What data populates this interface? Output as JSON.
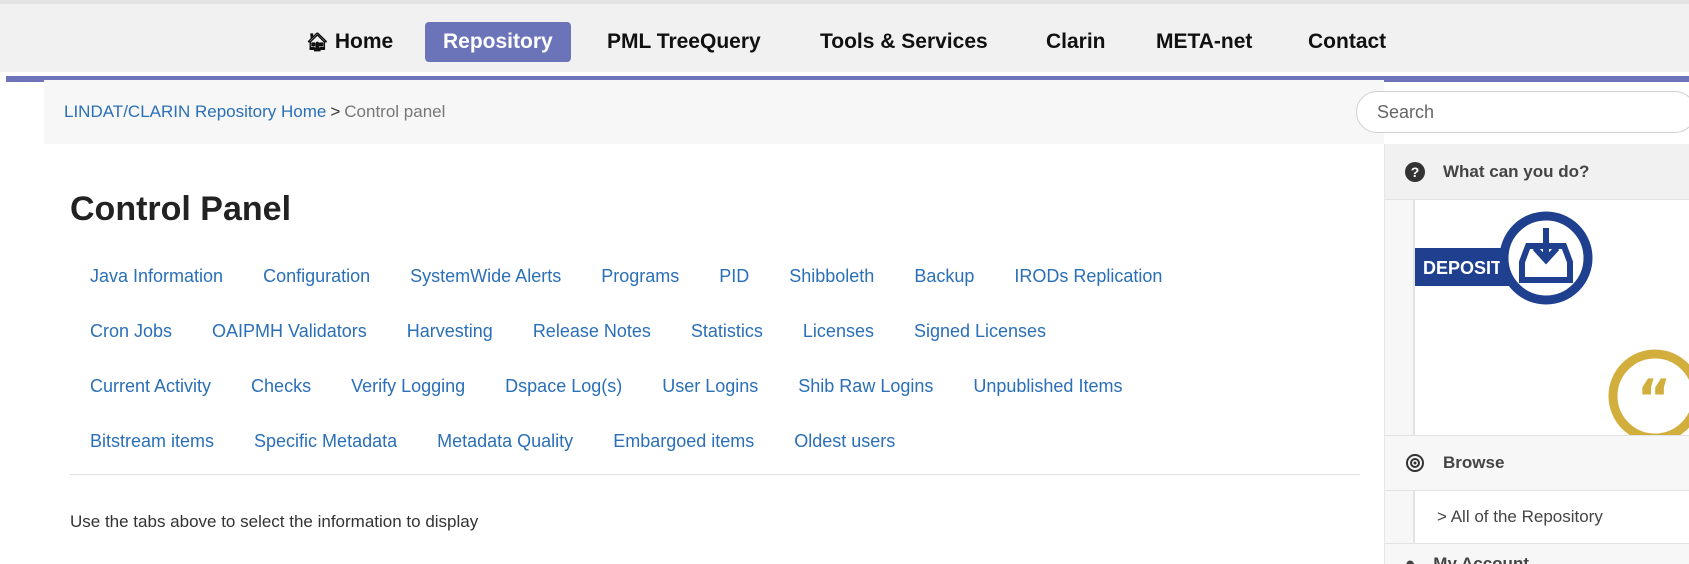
{
  "nav": {
    "home": "Home",
    "items": [
      "Repository",
      "PML TreeQuery",
      "Tools & Services",
      "Clarin",
      "META-net",
      "Contact"
    ]
  },
  "breadcrumb": {
    "home_link": "LINDAT/CLARIN Repository Home",
    "separator": ">",
    "current": "Control panel"
  },
  "search": {
    "placeholder": "Search"
  },
  "main": {
    "title": "Control Panel",
    "tab_rows": [
      [
        "Java Information",
        "Configuration",
        "SystemWide Alerts",
        "Programs",
        "PID",
        "Shibboleth",
        "Backup",
        "IRODs Replication"
      ],
      [
        "Cron Jobs",
        "OAIPMH Validators",
        "Harvesting",
        "Release Notes",
        "Statistics",
        "Licenses",
        "Signed Licenses"
      ],
      [
        "Current Activity",
        "Checks",
        "Verify Logging",
        "Dspace Log(s)",
        "User Logins",
        "Shib Raw Logins",
        "Unpublished Items"
      ],
      [
        "Bitstream items",
        "Specific Metadata",
        "Metadata Quality",
        "Embargoed items",
        "Oldest users"
      ]
    ],
    "help_text": "Use the tabs above to select the information to display"
  },
  "sidebar": {
    "what_can_you_do": "What can you do?",
    "deposit_label": "DEPOSIT",
    "browse_title": "Browse",
    "browse_link": "> All of the Repository",
    "account_title": "My Account"
  },
  "colors": {
    "accent": "#6b74b8",
    "link": "#2a6fb7",
    "deposit_blue": "#1f3f8f",
    "cite_gold": "#d2ae3c"
  }
}
